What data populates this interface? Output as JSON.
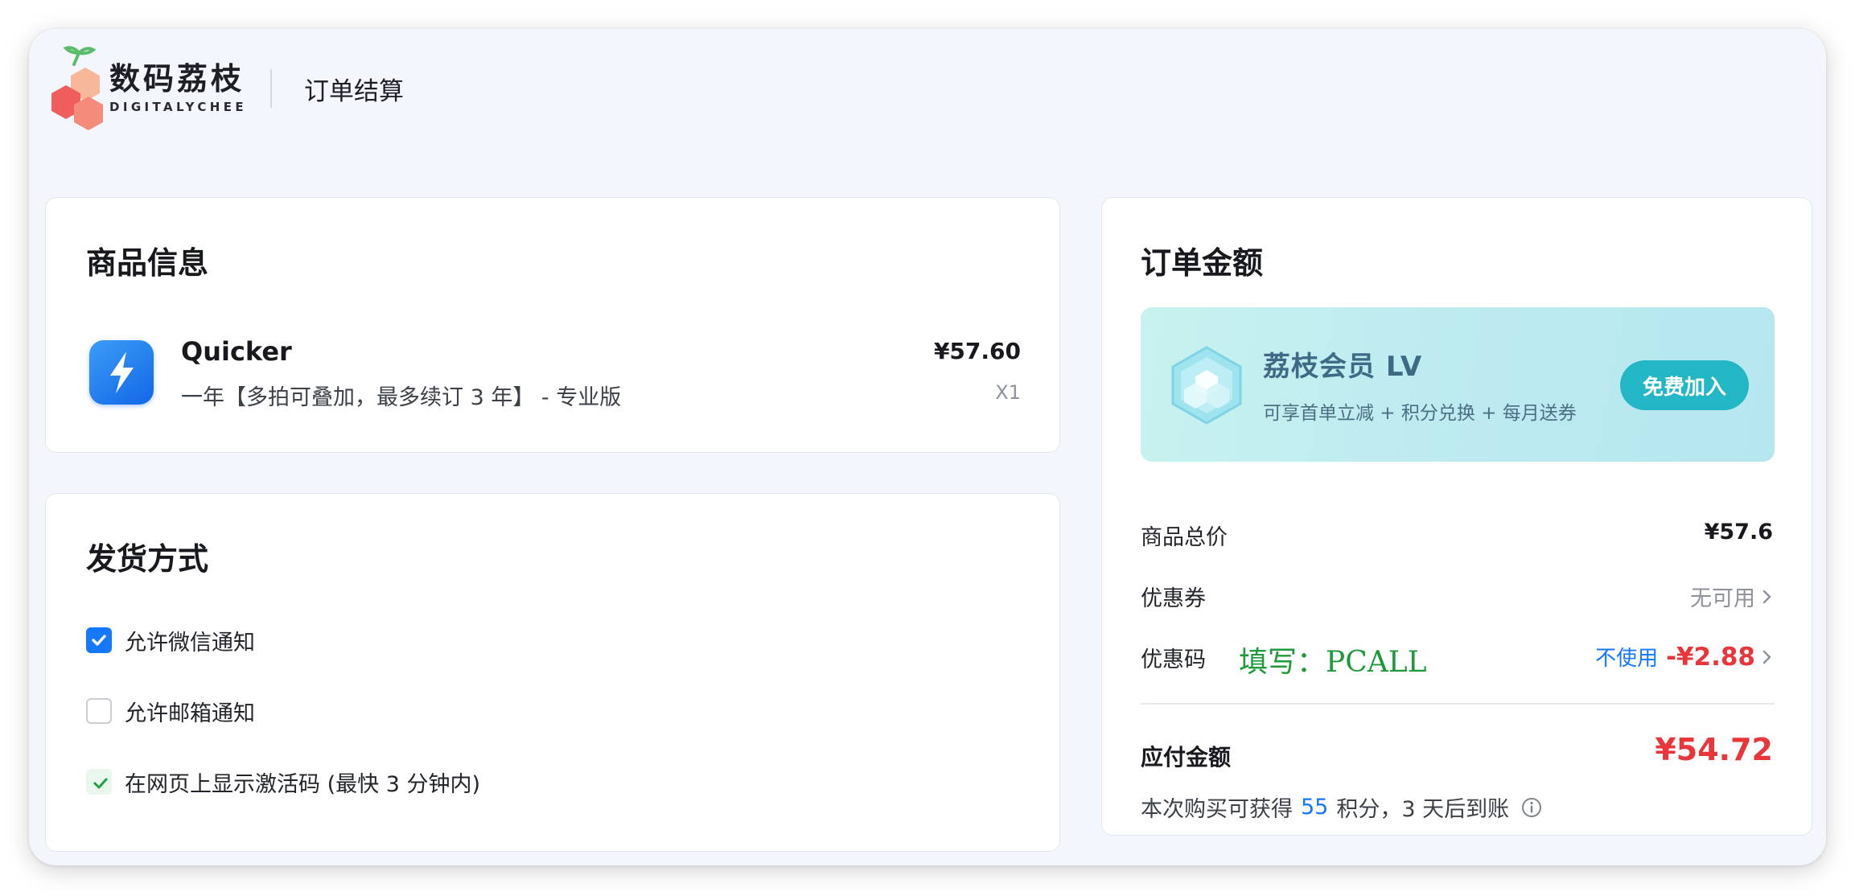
{
  "header": {
    "brand_cn": "数码荔枝",
    "brand_en": "DIGITALYCHEE",
    "page_title": "订单结算"
  },
  "product": {
    "section_title": "商品信息",
    "name": "Quicker",
    "description": "一年【多拍可叠加，最多续订 3 年】 - 专业版",
    "price": "¥57.60",
    "quantity": "X1",
    "icon": "lightning-bolt-icon"
  },
  "delivery": {
    "section_title": "发货方式",
    "options": [
      {
        "label": "允许微信通知",
        "checked": true
      },
      {
        "label": "允许邮箱通知",
        "checked": false
      },
      {
        "label": "在网页上显示激活码 (最快 3 分钟内)",
        "checked": true
      }
    ]
  },
  "order": {
    "section_title": "订单金额",
    "member": {
      "title": "荔枝会员 LV",
      "description": "可享首单立减 + 积分兑换 + 每月送券",
      "join_label": "免费加入"
    },
    "subtotal": {
      "label": "商品总价",
      "value": "¥57.6"
    },
    "coupon": {
      "label": "优惠券",
      "value": "无可用"
    },
    "promo_code": {
      "label": "优惠码",
      "hint": "填写：PCALL",
      "action": "不使用",
      "discount": "-¥2.88"
    },
    "payable": {
      "label": "应付金额",
      "value": "¥54.72"
    },
    "points": {
      "prefix": "本次购买可获得",
      "amount": "55",
      "suffix": "积分，3 天后到账"
    }
  },
  "colors": {
    "accent_blue": "#1677ff",
    "price_red": "#e8363a",
    "member_button": "#23b7c6",
    "promo_hint_green": "#1f9a3a"
  }
}
